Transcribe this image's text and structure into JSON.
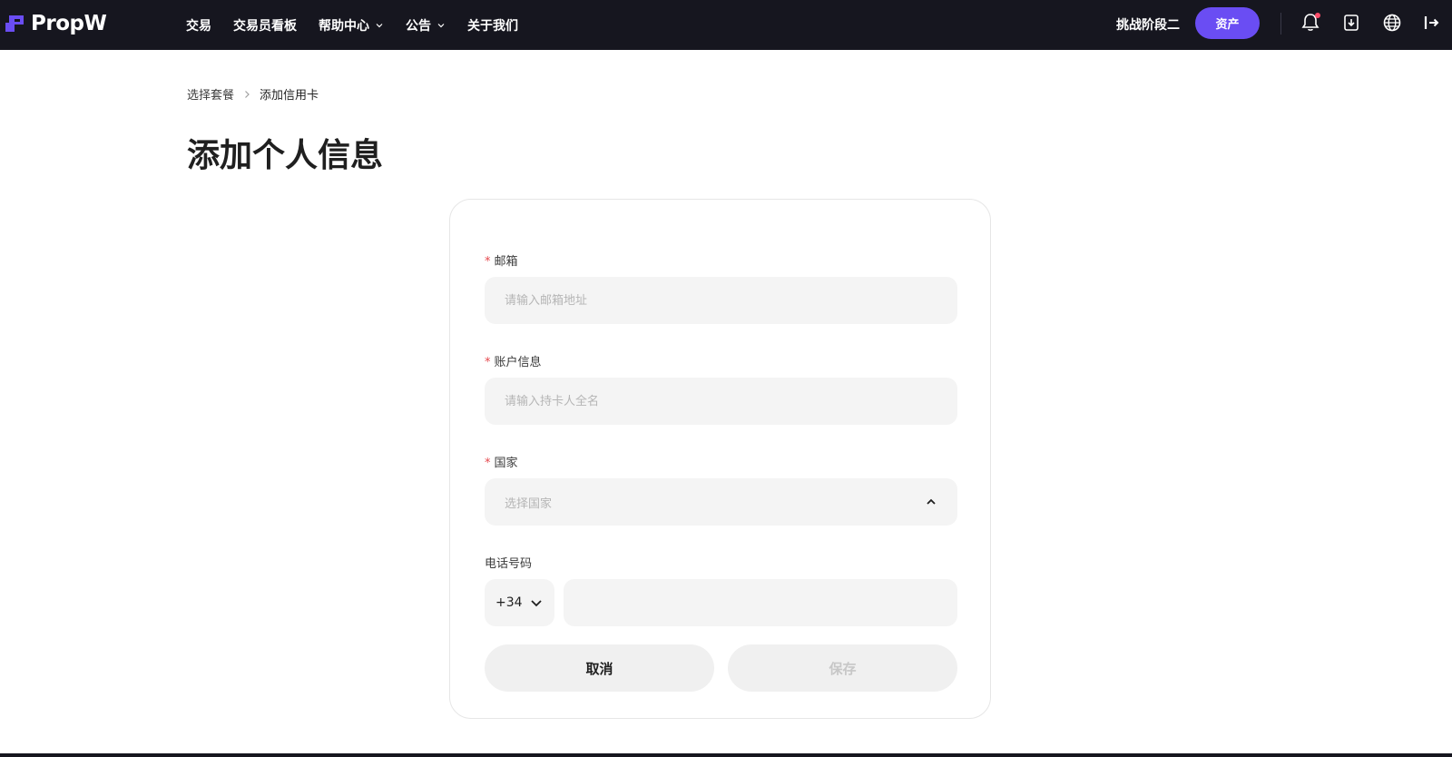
{
  "nav": {
    "brand": "PropW",
    "items": [
      {
        "label": "交易",
        "dropdown": false
      },
      {
        "label": "交易员看板",
        "dropdown": false
      },
      {
        "label": "帮助中心",
        "dropdown": true
      },
      {
        "label": "公告",
        "dropdown": true
      },
      {
        "label": "关于我们",
        "dropdown": false
      }
    ],
    "stage_label": "挑战阶段二",
    "assets_button": "资产",
    "icons": [
      "bell-icon",
      "download-icon",
      "globe-icon",
      "logout-icon"
    ]
  },
  "breadcrumb": {
    "parent": "选择套餐",
    "current": "添加信用卡"
  },
  "page_title": "添加个人信息",
  "form": {
    "required_mark": "*",
    "email": {
      "label": "邮箱",
      "placeholder": "请输入邮箱地址",
      "value": ""
    },
    "account": {
      "label": "账户信息",
      "placeholder": "请输入持卡人全名",
      "value": ""
    },
    "country": {
      "label": "国家",
      "placeholder": "选择国家"
    },
    "phone": {
      "label": "电话号码",
      "code": "+34",
      "value": ""
    },
    "cancel_label": "取消",
    "save_label": "保存"
  },
  "colors": {
    "nav_bg": "#16161f",
    "accent": "#6a4df3",
    "required": "#e5484d",
    "input_bg": "#f4f4f4"
  }
}
